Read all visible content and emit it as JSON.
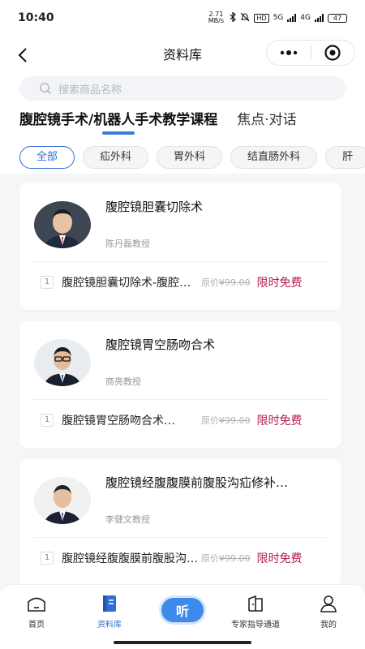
{
  "status_bar": {
    "time": "10:40",
    "net_speed": "2.71 MB/s",
    "hd_label": "HD",
    "net_5g": "5G",
    "net_4g": "4G",
    "battery": "47"
  },
  "header": {
    "title": "资料库"
  },
  "search": {
    "placeholder": "搜索商品名称"
  },
  "tabs": [
    {
      "label": "腹腔镜手术/机器人手术教学课程",
      "active": true
    },
    {
      "label": "焦点·对话",
      "active": false
    }
  ],
  "filters": [
    "全部",
    "疝外科",
    "胃外科",
    "结直肠外科",
    "肝"
  ],
  "courses": [
    {
      "title": "腹腔镜胆囊切除术",
      "teacher": "陈丹磊教授",
      "lesson_index": "1",
      "lesson_name": "腹腔镜胆囊切除术-腹腔镜胆囊切除术",
      "price_prefix": "原价",
      "price": "¥99.00",
      "promo": "限时免费"
    },
    {
      "title": "腹腔镜胃空肠吻合术",
      "teacher": "商亮教授",
      "lesson_index": "1",
      "lesson_name": "腹腔镜胃空肠吻合术…",
      "price_prefix": "原价",
      "price": "¥99.00",
      "promo": "限时免费"
    },
    {
      "title": "腹腔镜经腹腹膜前腹股沟疝修补…",
      "teacher": "李健文教授",
      "lesson_index": "1",
      "lesson_name": "腹腔镜经腹腹膜前腹股沟疝修补术",
      "price_prefix": "原价",
      "price": "¥99.00",
      "promo": "限时免费"
    }
  ],
  "tabbar": {
    "home": "首页",
    "library": "资料库",
    "listen": "听",
    "expert": "专家指导通道",
    "mine": "我的"
  },
  "colors": {
    "accent": "#2f6ed1",
    "promo": "#b21d4a",
    "listen": "#3d8aeb"
  }
}
